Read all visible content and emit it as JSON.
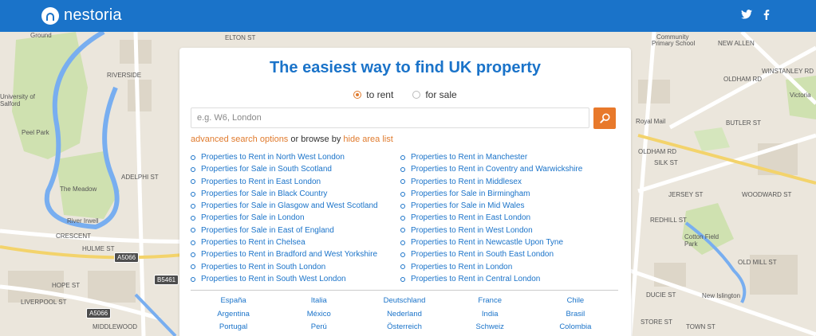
{
  "brand": {
    "name": "nestoria",
    "color": "#1a73c9",
    "accent": "#e8792b"
  },
  "header": {
    "social": [
      "twitter-icon",
      "facebook-icon"
    ]
  },
  "map": {
    "labels": [
      "ELTON ST",
      "Ground",
      "University of Salford",
      "Peel Park",
      "The Meadow",
      "CRESCENT",
      "HULME ST",
      "HOPE ST",
      "LIVERPOOL ST",
      "MIDDLEWOOD",
      "Community",
      "Primary School",
      "NEW ALLEN",
      "OLDHAM RD",
      "WINSTANLEY RD",
      "Victoria",
      "Royal Mail",
      "BUTLER ST",
      "Cotton Field Park",
      "New Islington",
      "OLD MILL ST",
      "DUCIE ST",
      "STORE ST",
      "TOWN ST",
      "RIVERSIDE",
      "ADELPHI ST",
      "River Irwell",
      "OLDHAM RD",
      "SILK ST",
      "JERSEY ST",
      "REDHILL ST",
      "WOODWARD ST"
    ],
    "roads": [
      "A5066",
      "B5461",
      "A5066"
    ]
  },
  "search": {
    "title": "The easiest way to find UK property",
    "radio_rent": "to rent",
    "radio_sale": "for sale",
    "placeholder": "e.g. W6, London",
    "advanced": "advanced search options",
    "browse_text": "or browse by",
    "hide_list": "hide area list"
  },
  "areas_left": [
    "Properties to Rent in North West London",
    "Properties for Sale in South Scotland",
    "Properties to Rent in East London",
    "Properties for Sale in Black Country",
    "Properties for Sale in Glasgow and West Scotland",
    "Properties for Sale in London",
    "Properties for Sale in East of England",
    "Properties to Rent in Chelsea",
    "Properties to Rent in Bradford and West Yorkshire",
    "Properties to Rent in South London",
    "Properties to Rent in South West London"
  ],
  "areas_right": [
    "Properties to Rent in Manchester",
    "Properties to Rent in Coventry and Warwickshire",
    "Properties to Rent in Middlesex",
    "Properties for Sale in Birmingham",
    "Properties for Sale in Mid Wales",
    "Properties to Rent in East London",
    "Properties to Rent in West London",
    "Properties to Rent in Newcastle Upon Tyne",
    "Properties to Rent in South East London",
    "Properties to Rent in London",
    "Properties to Rent in Central London"
  ],
  "countries": [
    "España",
    "Italia",
    "Deutschland",
    "France",
    "Chile",
    "Argentina",
    "México",
    "Nederland",
    "India",
    "Brasil",
    "Portugal",
    "Perú",
    "Österreich",
    "Schweiz",
    "Colombia"
  ]
}
